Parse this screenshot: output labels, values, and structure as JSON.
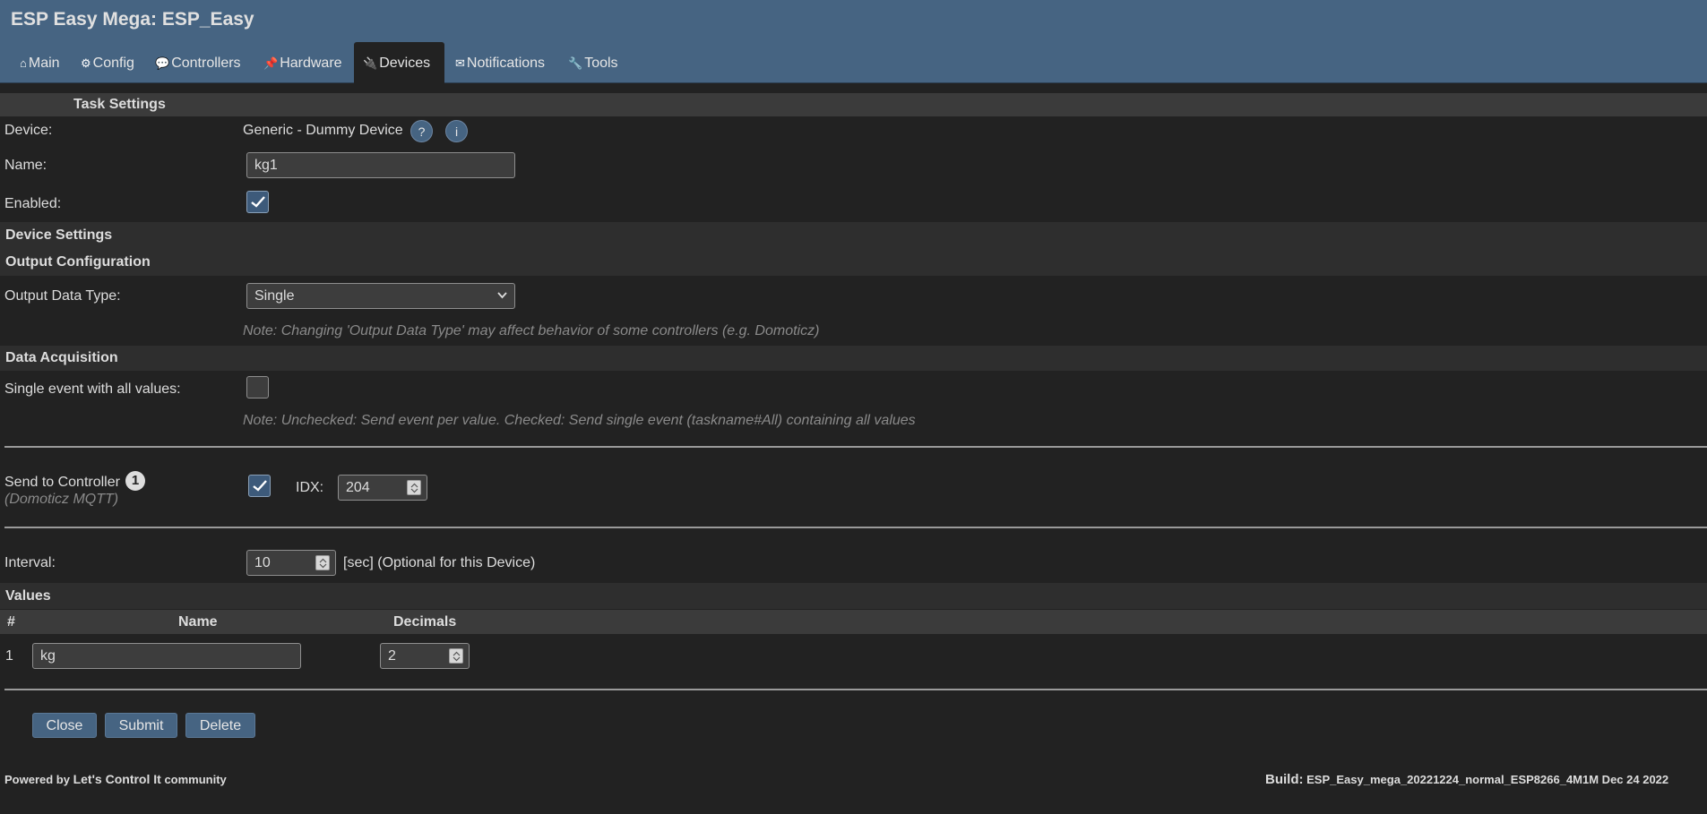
{
  "app": {
    "title": "ESP Easy Mega: ESP_Easy"
  },
  "tabs": [
    {
      "icon": "⌂",
      "label": "Main"
    },
    {
      "icon": "⚙",
      "label": "Config"
    },
    {
      "icon": "💬",
      "label": "Controllers"
    },
    {
      "icon": "📌",
      "label": "Hardware"
    },
    {
      "icon": "🔌",
      "label": "Devices",
      "active": true
    },
    {
      "icon": "✉",
      "label": "Notifications"
    },
    {
      "icon": "🔧",
      "label": "Tools"
    }
  ],
  "task_settings": {
    "header": "Task Settings",
    "device_label": "Device:",
    "device_value": "Generic - Dummy Device",
    "help_icon": "?",
    "info_icon": "i",
    "name_label": "Name:",
    "name_value": "kg1",
    "enabled_label": "Enabled:",
    "enabled": true
  },
  "device_settings": {
    "header": "Device Settings"
  },
  "output_config": {
    "header": "Output Configuration",
    "type_label": "Output Data Type:",
    "type_value": "Single",
    "note": "Note: Changing 'Output Data Type' may affect behavior of some controllers (e.g. Domoticz)"
  },
  "data_acquisition": {
    "header": "Data Acquisition",
    "single_event_label": "Single event with all values:",
    "single_event": false,
    "note": "Note: Unchecked: Send event per value. Checked: Send single event (taskname#All) containing all values"
  },
  "controller": {
    "label": "Send to Controller",
    "badge": "1",
    "sub": "(Domoticz MQTT)",
    "enabled": true,
    "idx_label": "IDX:",
    "idx_value": "204"
  },
  "interval": {
    "label": "Interval:",
    "value": "10",
    "suffix": "[sec] (Optional for this Device)"
  },
  "values": {
    "header": "Values",
    "col_hash": "#",
    "col_name": "Name",
    "col_decimals": "Decimals",
    "rows": [
      {
        "index": "1",
        "name": "kg",
        "decimals": "2"
      }
    ]
  },
  "buttons": {
    "close": "Close",
    "submit": "Submit",
    "delete": "Delete"
  },
  "footer": {
    "powered_by": "Powered by",
    "brand": "Let's Control It",
    "community": "community",
    "build_label": "Build:",
    "build_value": "ESP_Easy_mega_20221224_normal_ESP8266_4M1M Dec 24 2022"
  },
  "colors": {
    "header": "#466482",
    "background": "#222222",
    "band": "#3b3b3b"
  }
}
